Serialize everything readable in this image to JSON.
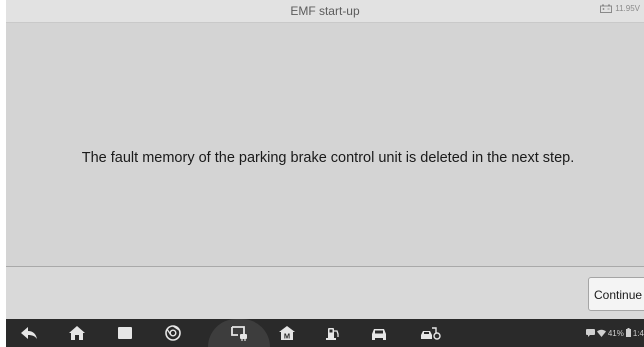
{
  "header": {
    "title": "EMF start-up",
    "battery_voltage": "11.95V"
  },
  "main": {
    "message": "The fault memory of the parking brake control unit is deleted in the next step."
  },
  "footer": {
    "continue_label": "Continue"
  },
  "navbar": {
    "icons": [
      "back-icon",
      "home-icon",
      "recent-apps-icon",
      "browser-icon",
      "vci-connect-icon",
      "maxifix-icon",
      "vehicle-service-icon",
      "vehicle-icon",
      "vehicle-diagnose-icon"
    ],
    "status": {
      "battery_percent": "41%",
      "time": "1:4"
    }
  },
  "colors": {
    "background": "#d4d4d4",
    "navbar": "#2a2a2a",
    "button": "#f4f4f4"
  }
}
